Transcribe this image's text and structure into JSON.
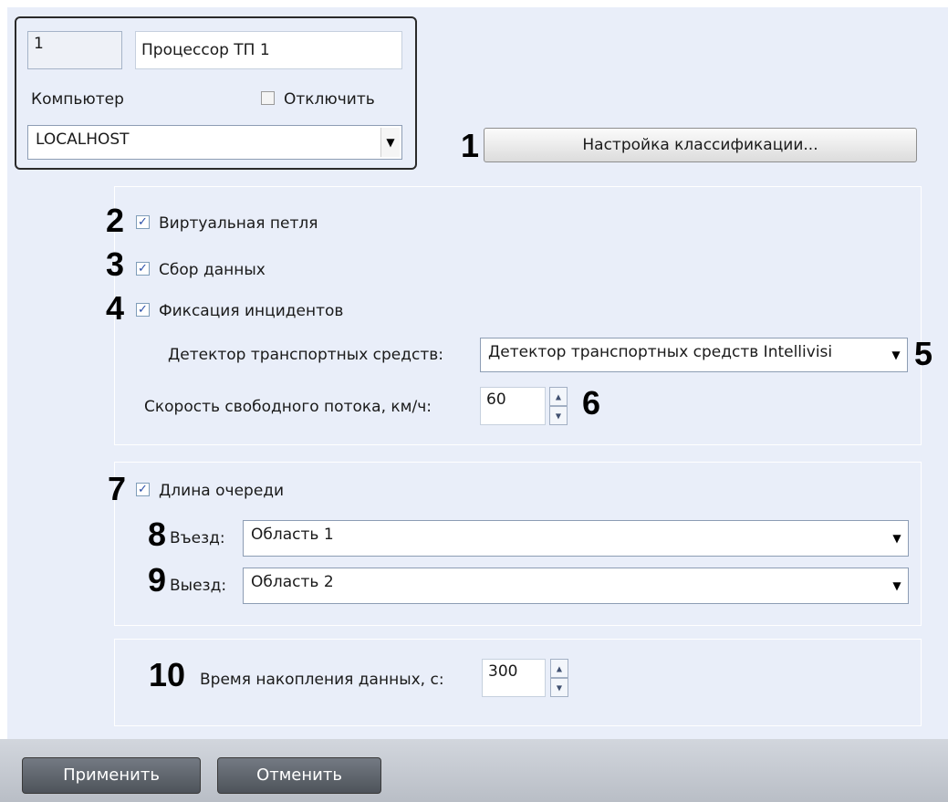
{
  "header": {
    "id_value": "1",
    "name_value": "Процессор ТП 1",
    "computer_label": "Компьютер",
    "disable_label": "Отключить",
    "computer_value": "LOCALHOST"
  },
  "classification": {
    "button_label": "Настройка классификации...",
    "marker": "1"
  },
  "options": {
    "virtual_loop": {
      "label": "Виртуальная петля",
      "marker": "2",
      "checked": true
    },
    "data_collection": {
      "label": "Сбор данных",
      "marker": "3",
      "checked": true
    },
    "incidents": {
      "label": "Фиксация инцидентов",
      "marker": "4",
      "checked": true
    },
    "detector_label": "Детектор транспортных средств:",
    "detector_value": "Детектор транспортных средств Intellivisi",
    "detector_marker": "5",
    "speed_label": "Скорость свободного потока, км/ч:",
    "speed_value": "60",
    "speed_marker": "6"
  },
  "queue": {
    "label": "Длина очереди",
    "marker": "7",
    "checked": true,
    "entry_label": "Въезд:",
    "entry_value": "Область 1",
    "entry_marker": "8",
    "exit_label": "Выезд:",
    "exit_value": "Область 2",
    "exit_marker": "9"
  },
  "accumulation": {
    "label": "Время накопления данных, с:",
    "value": "300",
    "marker": "10"
  },
  "footer": {
    "apply_label": "Применить",
    "cancel_label": "Отменить"
  }
}
